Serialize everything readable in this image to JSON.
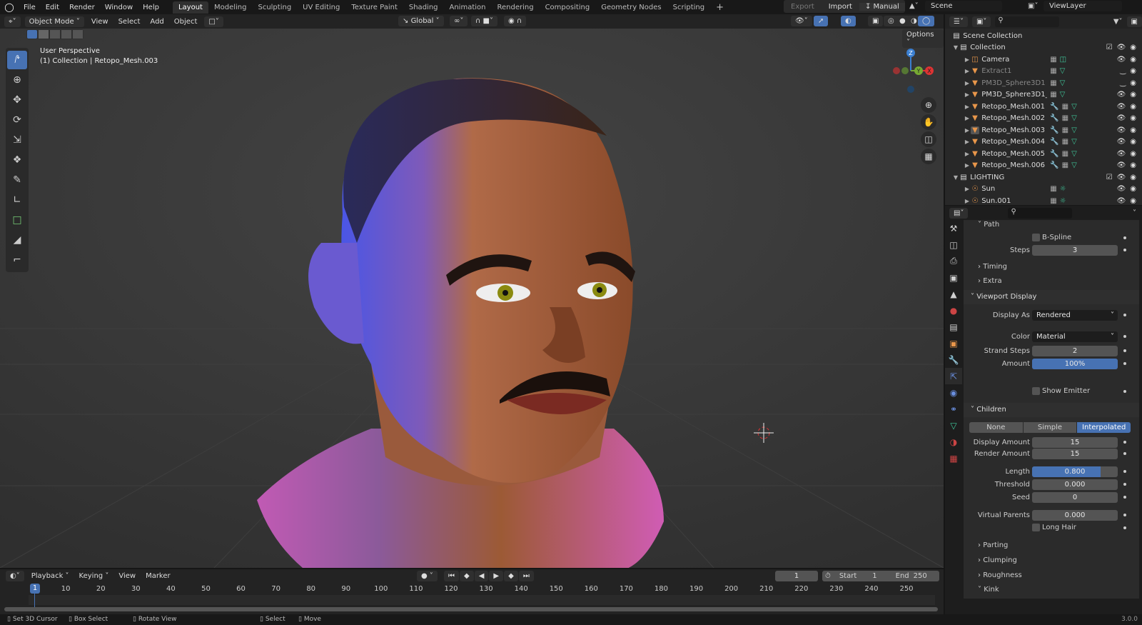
{
  "topbar": {
    "menus": [
      "File",
      "Edit",
      "Render",
      "Window",
      "Help"
    ],
    "workspaces": [
      "Layout",
      "Modeling",
      "Sculpting",
      "UV Editing",
      "Texture Paint",
      "Shading",
      "Animation",
      "Rendering",
      "Compositing",
      "Geometry Nodes",
      "Scripting"
    ],
    "active_workspace": "Layout",
    "add_label": "+",
    "export_label": "Export",
    "import_label": "Import",
    "manual_label": "Manual",
    "scene": "Scene",
    "view_layer": "ViewLayer"
  },
  "viewport": {
    "mode": "Object Mode",
    "menus": [
      "View",
      "Select",
      "Add",
      "Object"
    ],
    "orientation": "Global",
    "options_label": "Options",
    "overlay_title": "User Perspective",
    "overlay_sub": "(1) Collection | Retopo_Mesh.003",
    "axis": {
      "x": "X",
      "y": "Y",
      "z": "Z"
    }
  },
  "outliner": {
    "root": "Scene Collection",
    "collections": [
      {
        "name": "Collection",
        "items": [
          {
            "name": "Camera",
            "type": "camera",
            "visible": true
          },
          {
            "name": "Extract1",
            "type": "mesh",
            "visible": false
          },
          {
            "name": "PM3D_Sphere3D1",
            "type": "mesh",
            "visible": false
          },
          {
            "name": "PM3D_Sphere3D1_1",
            "type": "mesh",
            "visible": true
          },
          {
            "name": "Retopo_Mesh.001",
            "type": "mesh",
            "visible": true
          },
          {
            "name": "Retopo_Mesh.002",
            "type": "mesh",
            "visible": true
          },
          {
            "name": "Retopo_Mesh.003",
            "type": "mesh",
            "visible": true,
            "active": true
          },
          {
            "name": "Retopo_Mesh.004",
            "type": "mesh",
            "visible": true
          },
          {
            "name": "Retopo_Mesh.005",
            "type": "mesh",
            "visible": true
          },
          {
            "name": "Retopo_Mesh.006",
            "type": "mesh",
            "visible": true
          }
        ]
      },
      {
        "name": "LIGHTING",
        "items": [
          {
            "name": "Sun",
            "type": "light",
            "visible": true
          },
          {
            "name": "Sun.001",
            "type": "light",
            "visible": true
          }
        ]
      }
    ]
  },
  "properties": {
    "path": {
      "title": "Path",
      "bspline": "B-Spline",
      "steps_label": "Steps",
      "steps": "3",
      "timing": "Timing",
      "extra": "Extra"
    },
    "viewport_display": {
      "title": "Viewport Display",
      "display_as_label": "Display As",
      "display_as": "Rendered",
      "color_label": "Color",
      "color": "Material",
      "strand_steps_label": "Strand Steps",
      "strand_steps": "2",
      "amount_label": "Amount",
      "amount": "100%",
      "show_emitter": "Show Emitter"
    },
    "children": {
      "title": "Children",
      "modes": [
        "None",
        "Simple",
        "Interpolated"
      ],
      "active_mode": "Interpolated",
      "display_amount_label": "Display Amount",
      "display_amount": "15",
      "render_amount_label": "Render Amount",
      "render_amount": "15",
      "length_label": "Length",
      "length": "0.800",
      "length_fraction": 0.8,
      "threshold_label": "Threshold",
      "threshold": "0.000",
      "seed_label": "Seed",
      "seed": "0",
      "virtual_parents_label": "Virtual Parents",
      "virtual_parents": "0.000",
      "long_hair": "Long Hair",
      "subpanels": [
        "Parting",
        "Clumping",
        "Roughness",
        "Kink"
      ]
    }
  },
  "timeline": {
    "menus": [
      "Playback",
      "Keying",
      "View",
      "Marker"
    ],
    "current_frame": "1",
    "start_label": "Start",
    "start": "1",
    "end_label": "End",
    "end": "250",
    "ticks": [
      "10",
      "20",
      "30",
      "40",
      "50",
      "60",
      "70",
      "80",
      "90",
      "100",
      "110",
      "120",
      "130",
      "140",
      "150",
      "160",
      "170",
      "180",
      "190",
      "200",
      "210",
      "220",
      "230",
      "240",
      "250"
    ]
  },
  "status": {
    "hints": [
      "Set 3D Cursor",
      "Box Select",
      "Rotate View",
      "Select",
      "Move"
    ],
    "version": "3.0.0"
  },
  "colors": {
    "accent": "#4772b3",
    "mesh": "#e8964a",
    "data": "#3fc79a",
    "modifier": "#6a8fe0"
  }
}
